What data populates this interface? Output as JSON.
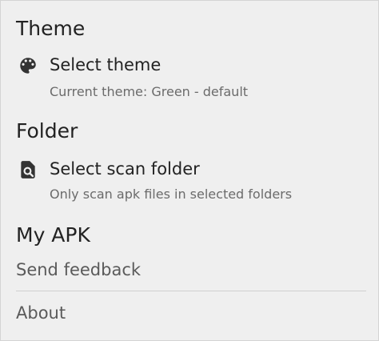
{
  "sections": {
    "theme": {
      "header": "Theme",
      "item": {
        "title": "Select theme",
        "summary": "Current theme: Green - default",
        "icon": "palette-icon"
      }
    },
    "folder": {
      "header": "Folder",
      "item": {
        "title": "Select scan folder",
        "summary": "Only scan apk files in selected folders",
        "icon": "folder-search-icon"
      }
    },
    "my_apk": {
      "header": "My APK",
      "items": [
        {
          "label": "Send feedback"
        },
        {
          "label": "About"
        }
      ]
    }
  },
  "colors": {
    "background": "#efefef",
    "text_primary": "#222222",
    "text_secondary": "#6b6b6b",
    "icon": "#333333",
    "divider": "#cfcfcf"
  }
}
